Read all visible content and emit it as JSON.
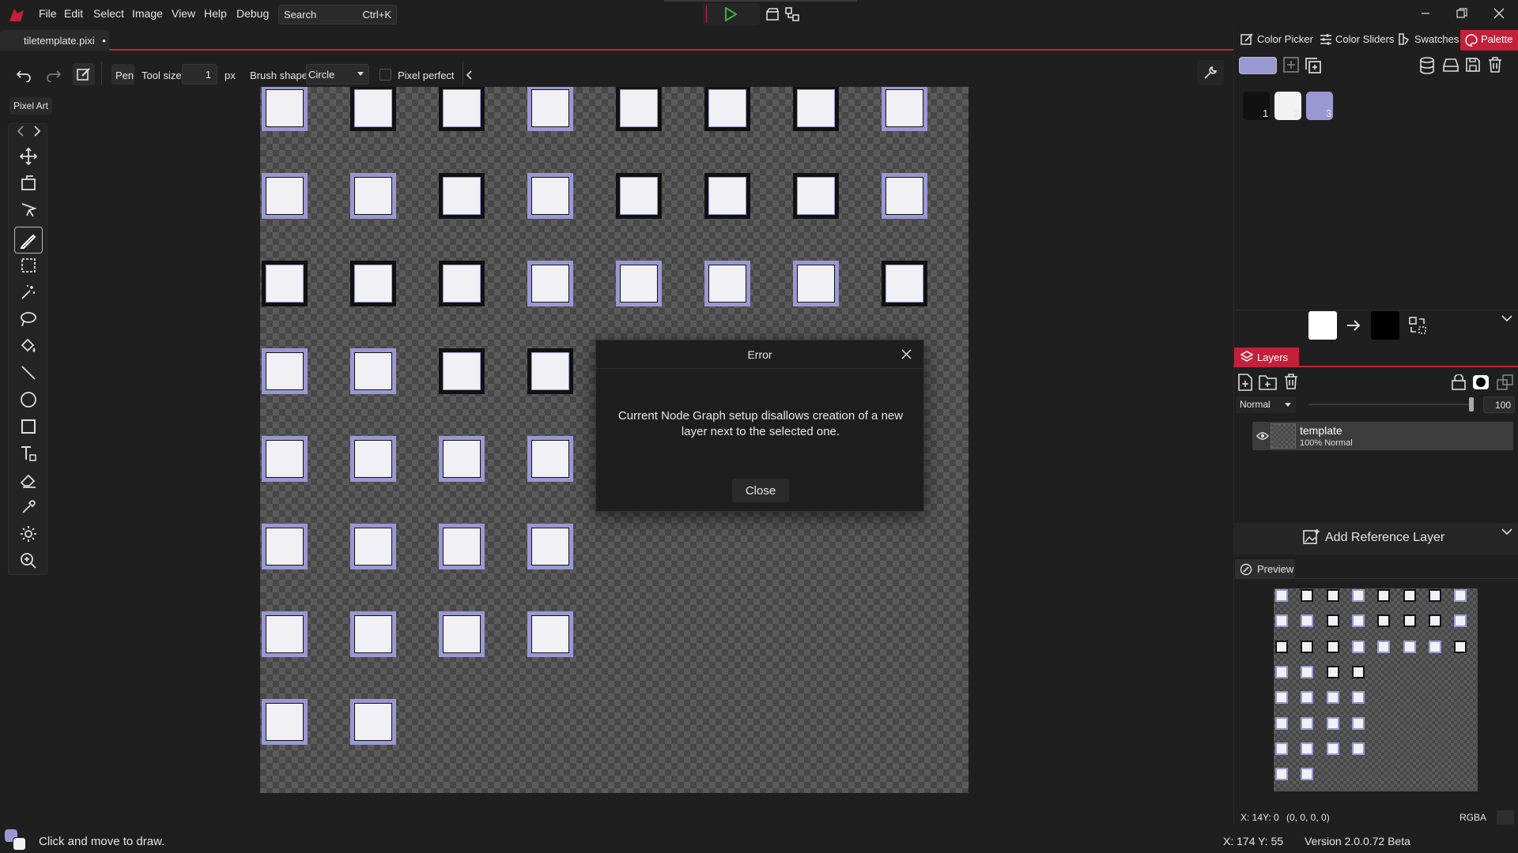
{
  "menu": {
    "file": "File",
    "edit": "Edit",
    "select": "Select",
    "image": "Image",
    "view": "View",
    "help": "Help",
    "debug": "Debug"
  },
  "search": {
    "label": "Search",
    "shortcut": "Ctrl+K"
  },
  "tab": {
    "title": "tiletemplate.pixi",
    "modified": "•"
  },
  "toolbar": {
    "tool": "Pen",
    "tool_size_label": "Tool size",
    "tool_size_value": "1",
    "unit": "px",
    "brush_shape_label": "Brush shape",
    "brush_shape_value": "Circle",
    "pixel_perfect": "Pixel perfect"
  },
  "tool_tooltip": "Pixel Art",
  "dialog": {
    "title": "Error",
    "message": "Current Node Graph setup disallows creation of a new layer next to the selected one.",
    "close": "Close"
  },
  "right_tabs": {
    "color_picker": "Color Picker",
    "color_sliders": "Color Sliders",
    "swatches": "Swatches",
    "palette": "Palette"
  },
  "palette": {
    "colors": [
      "#111111",
      "#f2f2f2",
      "#9a98d2"
    ],
    "indices": [
      "1",
      "2",
      "3"
    ],
    "primary": "#9a98d2"
  },
  "swap": {
    "from": "#ffffff",
    "to": "#000000"
  },
  "layers": {
    "title": "Layers",
    "blend": "Normal",
    "opacity": "100",
    "layer_name": "template",
    "layer_info": "100%  Normal"
  },
  "reference": "Add Reference Layer",
  "preview": {
    "title": "Preview"
  },
  "pixel_info": {
    "coords": "X: 14Y: 0",
    "rgba_value": "(0, 0, 0, 0)",
    "mode": "RGBA"
  },
  "status": {
    "hint": "Click and move to draw.",
    "cursor": "X: 174 Y: 55",
    "version": "Version 2.0.0.72 Beta"
  },
  "colors": {
    "accent": "#c4203a",
    "tile_border": "#9a98d2",
    "play": "#3cb043"
  },
  "tiles": {
    "rows": [
      8,
      8,
      8,
      4,
      4,
      4,
      4,
      2
    ]
  }
}
